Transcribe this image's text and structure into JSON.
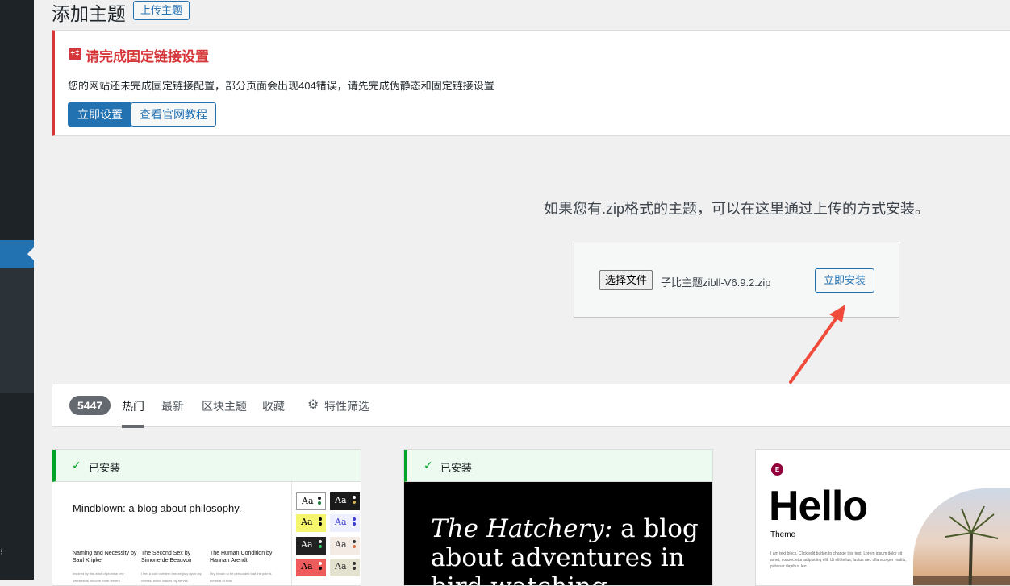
{
  "page": {
    "title": "添加主题",
    "upload_button": "上传主题"
  },
  "notice": {
    "title": "请完成固定链接设置",
    "text": "您的网站还未完成固定链接配置，部分页面会出现404错误，请先完成伪静态和固定链接设置",
    "setup_button": "立即设置",
    "tutorial_button": "查看官网教程"
  },
  "upload": {
    "help_text": "如果您有.zip格式的主题，可以在这里通过上传的方式安装。",
    "choose_file_button": "选择文件",
    "chosen_file": "子比主题zibll-V6.9.2.zip",
    "install_button": "立即安装"
  },
  "filter_bar": {
    "count": "5447",
    "tabs": [
      "热门",
      "最新",
      "区块主题",
      "收藏"
    ],
    "feature_filter": "特性筛选"
  },
  "cards": [
    {
      "installed_label": "已安装",
      "preview_title": "Mindblown: a blog about philosophy.",
      "columns": [
        {
          "title": "Naming and Necessity by Saul Kripke",
          "fine": "Inspired by this wind of promise, my daydreams become more fervent"
        },
        {
          "title": "The Second Sex by Simone de Beauvoir",
          "fine": "I feel a cold northern breeze play upon my cheeks, which braces my nerves"
        },
        {
          "title": "The Human Condition by Hannah Arendt",
          "fine": "I try in vain to be persuaded that the pole is the seat of frost"
        }
      ],
      "swatch_label": "Aa"
    },
    {
      "installed_label": "已安装",
      "preview_text_italic": "The Hatchery:",
      "preview_text_rest": " a blog about adventures in bird watching."
    },
    {
      "preview_title": "Hello",
      "preview_sub": "Theme",
      "preview_fine": "I am text block. Click edit button to change this text. Lorem ipsum dolor sit amet, consectetur adipiscing elit. Ut elit tellus, luctus nec ullamcorper mattis, pulvinar dapibus leo."
    }
  ],
  "colors": {
    "accent": "#2271b1",
    "error": "#d63638",
    "success": "#00a32a",
    "sidebar": "#1d2327"
  }
}
